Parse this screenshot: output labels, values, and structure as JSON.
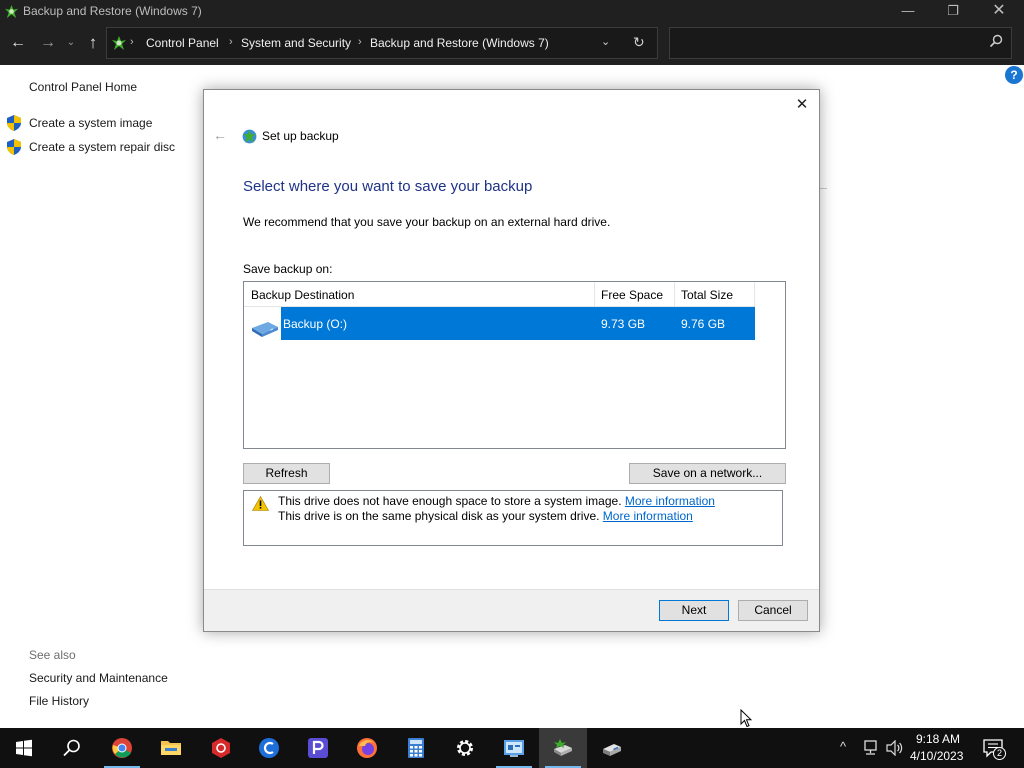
{
  "window": {
    "title": "Backup and Restore (Windows 7)",
    "minimize_glyph": "—",
    "maximize_glyph": "❐",
    "close_glyph": "✕"
  },
  "address": {
    "back_glyph": "←",
    "forward_glyph": "→",
    "recent_glyph": "⌄",
    "up_glyph": "↑",
    "separator": "›",
    "crumbs": [
      "Control Panel",
      "System and Security",
      "Backup and Restore (Windows 7)"
    ],
    "dropdown_glyph": "⌄",
    "refresh_glyph": "↻",
    "search_placeholder": ""
  },
  "control_panel": {
    "help_glyph": "?",
    "home_link": "Control Panel Home",
    "task_links": [
      "Create a system image",
      "Create a system repair disc"
    ],
    "see_also_label": "See also",
    "see_also_links": [
      "Security and Maintenance",
      "File History"
    ]
  },
  "dialog": {
    "close_glyph": "✕",
    "back_glyph": "←",
    "title": "Set up backup",
    "heading": "Select where you want to save your backup",
    "recommendation": "We recommend that you save your backup on an external hard drive.",
    "save_label": "Save backup on:",
    "columns": [
      "Backup Destination",
      "Free Space",
      "Total Size"
    ],
    "destinations": [
      {
        "name": "Backup (O:)",
        "free_space": "9.73 GB",
        "total_size": "9.76 GB",
        "selected": true
      }
    ],
    "refresh_button": "Refresh",
    "network_button": "Save on a network...",
    "warnings": [
      {
        "text": "This drive does not have enough space to store a system image.",
        "link": "More information"
      },
      {
        "text": "This drive is on the same physical disk as your system drive.",
        "link": "More information"
      }
    ],
    "next_button": "Next",
    "cancel_button": "Cancel"
  },
  "taskbar": {
    "apps": [
      "start-icon",
      "search-icon",
      "chrome-icon",
      "file-explorer-icon",
      "red-app-icon",
      "c-app-icon",
      "p-app-icon",
      "firefox-icon",
      "calculator-icon",
      "settings-icon",
      "control-panel-icon",
      "backup-icon",
      "backup-drive-icon"
    ],
    "tray_chevron": "^",
    "time": "9:18 AM",
    "date": "4/10/2023",
    "notification_count": "2"
  },
  "colors": {
    "accent": "#0078d7",
    "heading_blue": "#1e3287",
    "link": "#0066cc",
    "titlebar": "#202020",
    "taskbar": "#101010"
  }
}
